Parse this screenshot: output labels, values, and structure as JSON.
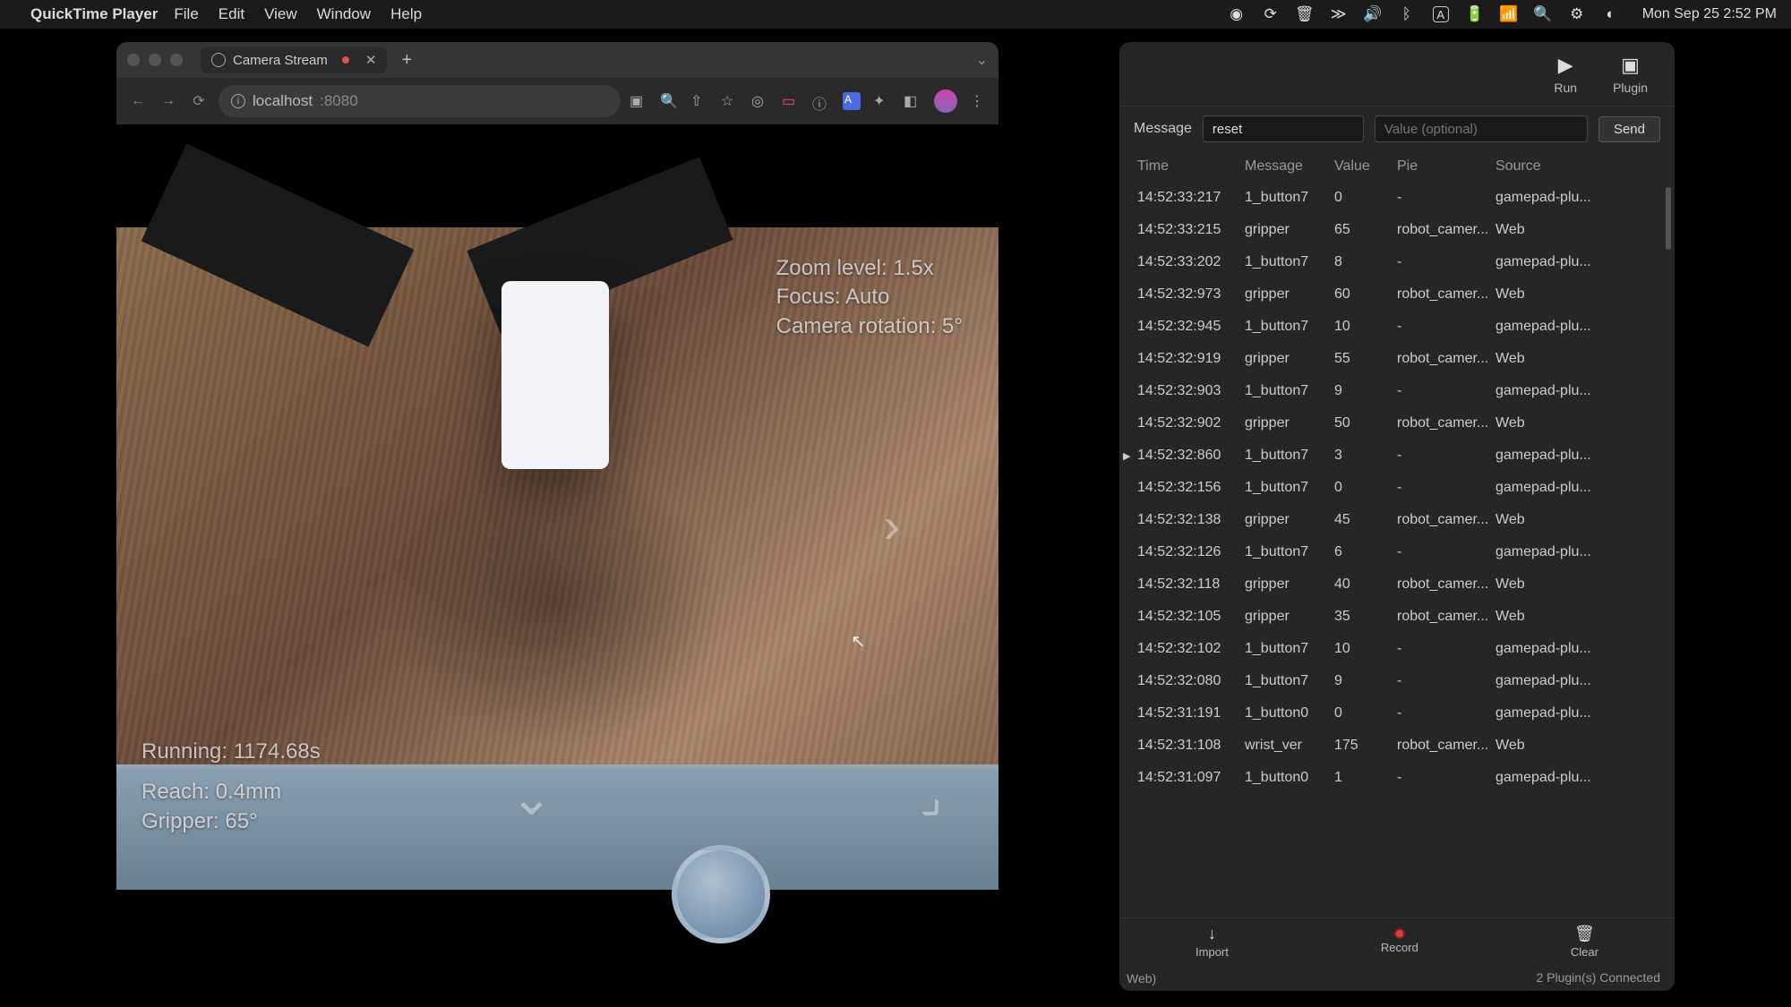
{
  "menubar": {
    "app": "QuickTime Player",
    "items": [
      "File",
      "Edit",
      "View",
      "Window",
      "Help"
    ],
    "clock": "Mon Sep 25  2:52 PM"
  },
  "browser": {
    "tab_title": "Camera Stream",
    "url_host": "localhost",
    "url_port": ":8080",
    "newtab": "+"
  },
  "camera_overlay": {
    "zoom": "Zoom level: 1.5x",
    "focus": "Focus: Auto",
    "rotation": "Camera rotation: 5°",
    "running": "Running: 1174.68s",
    "reach": "Reach: 0.4mm",
    "gripper": "Gripper: 65°"
  },
  "panel": {
    "run": "Run",
    "plugin": "Plugin",
    "msg_label": "Message",
    "msg_value": "reset",
    "val_placeholder": "Value (optional)",
    "send": "Send",
    "headers": {
      "time": "Time",
      "message": "Message",
      "value": "Value",
      "pie": "Pie",
      "source": "Source"
    },
    "rows": [
      {
        "time": "14:52:33:217",
        "msg": "1_button7",
        "val": "0",
        "pie": "-",
        "src": "gamepad-plu..."
      },
      {
        "time": "14:52:33:215",
        "msg": "gripper",
        "val": "65",
        "pie": "robot_camer...",
        "src": "Web"
      },
      {
        "time": "14:52:33:202",
        "msg": "1_button7",
        "val": "8",
        "pie": "-",
        "src": "gamepad-plu..."
      },
      {
        "time": "14:52:32:973",
        "msg": "gripper",
        "val": "60",
        "pie": "robot_camer...",
        "src": "Web"
      },
      {
        "time": "14:52:32:945",
        "msg": "1_button7",
        "val": "10",
        "pie": "-",
        "src": "gamepad-plu..."
      },
      {
        "time": "14:52:32:919",
        "msg": "gripper",
        "val": "55",
        "pie": "robot_camer...",
        "src": "Web"
      },
      {
        "time": "14:52:32:903",
        "msg": "1_button7",
        "val": "9",
        "pie": "-",
        "src": "gamepad-plu..."
      },
      {
        "time": "14:52:32:902",
        "msg": "gripper",
        "val": "50",
        "pie": "robot_camer...",
        "src": "Web"
      },
      {
        "time": "14:52:32:860",
        "msg": "1_button7",
        "val": "3",
        "pie": "-",
        "src": "gamepad-plu...",
        "marked": true
      },
      {
        "time": "14:52:32:156",
        "msg": "1_button7",
        "val": "0",
        "pie": "-",
        "src": "gamepad-plu..."
      },
      {
        "time": "14:52:32:138",
        "msg": "gripper",
        "val": "45",
        "pie": "robot_camer...",
        "src": "Web"
      },
      {
        "time": "14:52:32:126",
        "msg": "1_button7",
        "val": "6",
        "pie": "-",
        "src": "gamepad-plu..."
      },
      {
        "time": "14:52:32:118",
        "msg": "gripper",
        "val": "40",
        "pie": "robot_camer...",
        "src": "Web"
      },
      {
        "time": "14:52:32:105",
        "msg": "gripper",
        "val": "35",
        "pie": "robot_camer...",
        "src": "Web"
      },
      {
        "time": "14:52:32:102",
        "msg": "1_button7",
        "val": "10",
        "pie": "-",
        "src": "gamepad-plu..."
      },
      {
        "time": "14:52:32:080",
        "msg": "1_button7",
        "val": "9",
        "pie": "-",
        "src": "gamepad-plu..."
      },
      {
        "time": "14:52:31:191",
        "msg": "1_button0",
        "val": "0",
        "pie": "-",
        "src": "gamepad-plu..."
      },
      {
        "time": "14:52:31:108",
        "msg": "wrist_ver",
        "val": "175",
        "pie": "robot_camer...",
        "src": "Web"
      },
      {
        "time": "14:52:31:097",
        "msg": "1_button0",
        "val": "1",
        "pie": "-",
        "src": "gamepad-plu..."
      }
    ],
    "footer": {
      "import": "Import",
      "record": "Record",
      "clear": "Clear"
    },
    "status_right": "2 Plugin(s) Connected",
    "status_left": "Web)"
  }
}
